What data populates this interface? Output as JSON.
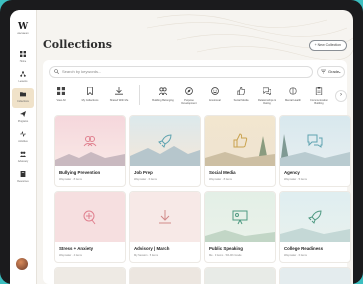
{
  "sidebar": {
    "logo": "W",
    "logo_sub": "WAYMAKER",
    "items": [
      {
        "label": "Home",
        "icon": "grid-icon"
      },
      {
        "label": "Lessons",
        "icon": "network-icon"
      },
      {
        "label": "Collections",
        "icon": "folder-icon",
        "active": true
      },
      {
        "label": "Programs",
        "icon": "send-icon"
      },
      {
        "label": "Activities",
        "icon": "activity-icon"
      },
      {
        "label": "Advocacy",
        "icon": "people-icon"
      },
      {
        "label": "Resources",
        "icon": "book-icon"
      }
    ]
  },
  "header": {
    "title": "Collections",
    "new_button": "+ New Collection"
  },
  "search": {
    "placeholder": "Search by keywords...",
    "grade_label": "Grade",
    "grade_chevron": "⌄"
  },
  "filters": [
    {
      "label": "View All",
      "icon": "grid-icon"
    },
    {
      "label": "My Collections",
      "icon": "bookmark-icon"
    },
    {
      "label": "Shared With Me",
      "icon": "download-icon"
    },
    {
      "label": "Building Belonging",
      "icon": "people-icon"
    },
    {
      "label": "Purpose Development",
      "icon": "compass-icon"
    },
    {
      "label": "Emotional",
      "icon": "smile-icon"
    },
    {
      "label": "Social Media",
      "icon": "thumbs-up-icon"
    },
    {
      "label": "Relationships & Dating",
      "icon": "chat-icon"
    },
    {
      "label": "Mental Health",
      "icon": "brain-icon"
    },
    {
      "label": "Communication Building",
      "icon": "clipboard-icon"
    }
  ],
  "next_symbol": "›",
  "cards": [
    {
      "title": "Bullying Prevention",
      "meta": "Waymaker  ·  8 items",
      "icon": "people-icon"
    },
    {
      "title": "Job Prep",
      "meta": "Waymaker  ·  6 items",
      "icon": "rocket-icon"
    },
    {
      "title": "Social Media",
      "meta": "Waymaker  ·  8 items",
      "icon": "thumbs-up-icon"
    },
    {
      "title": "Agency",
      "meta": "Waymaker  ·  5 items",
      "icon": "chat-icon"
    },
    {
      "title": "Stress + Anxiety",
      "meta": "Waymaker  ·  4 items",
      "icon": "brain-icon"
    },
    {
      "title": "Advisory | March",
      "meta": "My Session  ·  5 items",
      "icon": "download-icon"
    },
    {
      "title": "Public Speaking",
      "meta": "Me  ·  3 items  ·  5th-9th Grade",
      "icon": "presentation-icon"
    },
    {
      "title": "College Readiness",
      "meta": "Waymaker  ·  6 items",
      "icon": "rocket-icon"
    }
  ]
}
